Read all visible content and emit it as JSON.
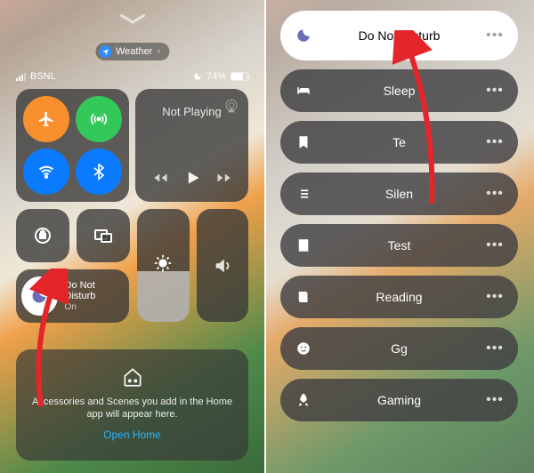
{
  "left": {
    "app_tag": {
      "label": "Weather"
    },
    "status": {
      "carrier": "BSNL",
      "battery_pct": "74%"
    },
    "music": {
      "title": "Not Playing"
    },
    "dnd": {
      "title": "Do Not Disturb",
      "state": "On"
    },
    "home": {
      "msg": "Accessories and Scenes you add in the Home app will appear here.",
      "link": "Open Home"
    }
  },
  "right": {
    "dnd": {
      "title": "Do Not Disturb",
      "state": "On"
    },
    "items": [
      {
        "label": "Sleep"
      },
      {
        "label": "Te"
      },
      {
        "label": "Silen"
      },
      {
        "label": "Test"
      },
      {
        "label": "Reading"
      },
      {
        "label": "Gg"
      },
      {
        "label": "Gaming"
      }
    ]
  }
}
